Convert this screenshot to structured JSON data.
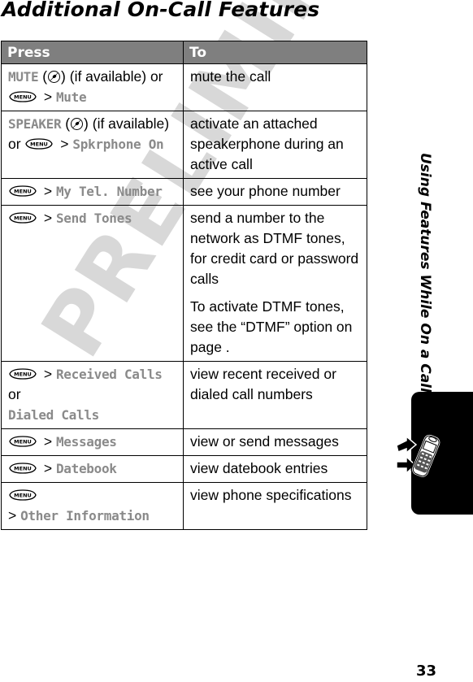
{
  "page": {
    "title": "Additional On-Call Features",
    "watermark": "PRELIMINARY",
    "side_title": "Using Features While On a Call",
    "page_number": "33"
  },
  "icons": {
    "menu_key": "menu-key-icon",
    "soft_key": "soft-key-icon",
    "chapter_tab": "phone-with-arrows-icon"
  },
  "table": {
    "headers": [
      "Press",
      "To"
    ],
    "rows": [
      {
        "press": [
          {
            "type": "menu",
            "text": "MUTE"
          },
          {
            "type": "plain",
            "text": " ("
          },
          {
            "type": "softkey"
          },
          {
            "type": "plain",
            "text": ") (if available) or"
          },
          {
            "type": "break"
          },
          {
            "type": "menukey"
          },
          {
            "type": "plain",
            "text": " > "
          },
          {
            "type": "menu",
            "text": "Mute"
          }
        ],
        "to": [
          "mute the call"
        ]
      },
      {
        "press": [
          {
            "type": "menu",
            "text": "SPEAKER"
          },
          {
            "type": "plain",
            "text": " ("
          },
          {
            "type": "softkey"
          },
          {
            "type": "plain",
            "text": ") (if available)"
          },
          {
            "type": "break"
          },
          {
            "type": "plain",
            "text": "or "
          },
          {
            "type": "menukey"
          },
          {
            "type": "plain",
            "text": " > "
          },
          {
            "type": "menu",
            "text": "Spkrphone On"
          }
        ],
        "to": [
          "activate an attached speakerphone during an active call"
        ]
      },
      {
        "press": [
          {
            "type": "menukey"
          },
          {
            "type": "plain",
            "text": " > "
          },
          {
            "type": "menu",
            "text": "My Tel. Number"
          }
        ],
        "to": [
          "see your phone number"
        ]
      },
      {
        "press": [
          {
            "type": "menukey"
          },
          {
            "type": "plain",
            "text": " > "
          },
          {
            "type": "menu",
            "text": "Send Tones"
          }
        ],
        "to": [
          "send a number to the network as DTMF tones, for credit card or password calls",
          "To activate DTMF tones, see the “DTMF” option on page ."
        ]
      },
      {
        "press": [
          {
            "type": "menukey"
          },
          {
            "type": "plain",
            "text": " > "
          },
          {
            "type": "menu",
            "text": "Received Calls"
          },
          {
            "type": "plain",
            "text": " or"
          },
          {
            "type": "break"
          },
          {
            "type": "menu",
            "text": "Dialed Calls"
          }
        ],
        "to": [
          "view recent received or dialed call numbers"
        ]
      },
      {
        "press": [
          {
            "type": "menukey"
          },
          {
            "type": "plain",
            "text": " > "
          },
          {
            "type": "menu",
            "text": "Messages"
          }
        ],
        "to": [
          "view or send messages"
        ]
      },
      {
        "press": [
          {
            "type": "menukey"
          },
          {
            "type": "plain",
            "text": " > "
          },
          {
            "type": "menu",
            "text": "Datebook"
          }
        ],
        "to": [
          "view datebook entries"
        ]
      },
      {
        "press": [
          {
            "type": "menukey"
          },
          {
            "type": "break"
          },
          {
            "type": "plain",
            "text": "> "
          },
          {
            "type": "menu",
            "text": "Other Information"
          }
        ],
        "to": [
          "view phone specifications"
        ]
      }
    ]
  }
}
